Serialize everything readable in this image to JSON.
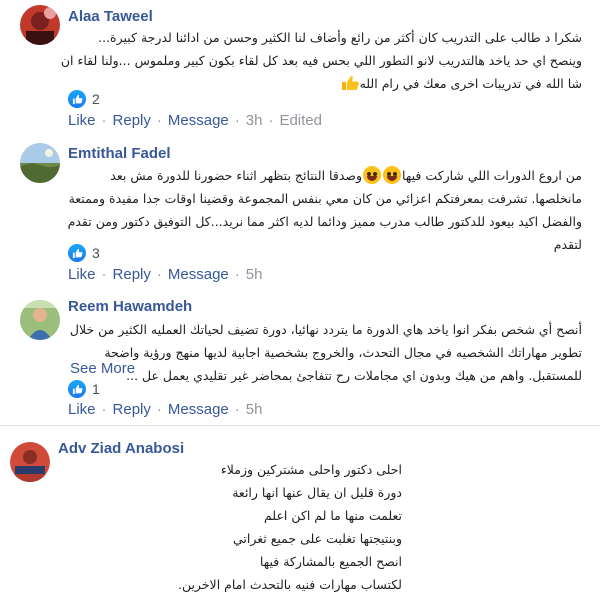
{
  "comments": [
    {
      "author": "Alaa Taweel",
      "lines": [
        "شكرا د طالب على التدريب كان أكثر من رائع وأضاف لنا الكثير وحسن من ادائنا لدرجة كبيرة...",
        "وينصح اي حد ياخد هالتدريب لانو التطور اللي بحس فيه بعد كل لقاء بكون كبير وملموس ...ولنا لقاء ان",
        "شا الله في تدريبات اخرى معك في رام الله"
      ],
      "reactions": "2",
      "like": "Like",
      "reply": "Reply",
      "message": "Message",
      "time": "3h",
      "edited": "Edited"
    },
    {
      "author": "Emtithal Fadel",
      "lines": [
        "من اروع الدورات اللي شاركت فيها",
        "وصدقا النتائج بتظهر اثناء حضورنا للدورة مش بعد",
        "مانخلصها. تشرفت بمعرفتكم اعزائي من كان معي بنفس المجموعة وقضينا اوقات جدا مفيدة وممتعة",
        "والفضل اكيد بيعود للدكتور طالب مدرب مميز ودائما لديه اكثر مما نريد...كل التوفيق دكتور ومن تقدم",
        "لتقدم"
      ],
      "reactions": "3",
      "like": "Like",
      "reply": "Reply",
      "message": "Message",
      "time": "5h"
    },
    {
      "author": "Reem Hawamdeh",
      "lines": [
        "أنصح أي شخص بفكر انوا ياخد هاي الدورة ما يتردد نهائيا، دورة تضيف لحياتك العمليه الكثير من خلال",
        "تطوير مهاراتك الشخصيه في مجال التحدث، والخروج بشخصية اجابية لديها منهج ورؤية واضحة",
        "للمستقبل. واهم من هيك وبدون اي مجاملات رح تتفاجئ بمحاضر غير تقليدي يعمل عل ..."
      ],
      "see_more": "See More",
      "reactions": "1",
      "like": "Like",
      "reply": "Reply",
      "message": "Message",
      "time": "5h"
    },
    {
      "author": "Adv Ziad Anabosi",
      "lines": [
        "احلى دكتور واحلى مشتركين وزملاء",
        "دورة قليل ان يقال عنها انها رائعة",
        "تعلمت منها ما لم اكن اعلم",
        "وبنتيجتها تغلبت على جميع ثغراتي",
        "انصح الجميع بالمشاركة فيها",
        "لكتساب مهارات فنيه بالتحدث امام الاخرين."
      ]
    }
  ]
}
